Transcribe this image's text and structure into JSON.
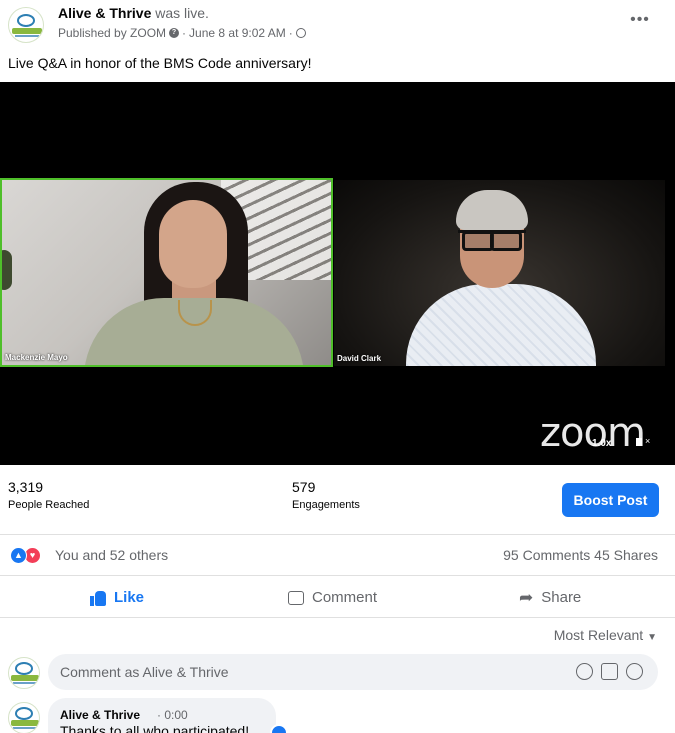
{
  "post": {
    "page_name": "Alive & Thrive",
    "was_live": "was live.",
    "published_by": "Published by ZOOM",
    "date": "June 8 at 9:02 AM",
    "more_label": "•••",
    "caption": "Live Q&A in honor of the BMS Code anniversary!"
  },
  "video": {
    "participant_left": "Mackenzie Mayo",
    "participant_right": "David Clark",
    "logo_text": "zoom",
    "speed": "1.0x"
  },
  "stats": {
    "reach_value": "3,319",
    "reach_label": "People Reached",
    "engagements_value": "579",
    "engagements_label": "Engagements",
    "boost_label": "Boost Post"
  },
  "reactions": {
    "summary": "You and 52 others",
    "comments": "95 Comments",
    "shares": "45 Shares"
  },
  "actions": {
    "like": "Like",
    "comment": "Comment",
    "share": "Share"
  },
  "comments": {
    "sort_label": "Most Relevant",
    "input_placeholder": "Comment as Alive & Thrive",
    "first": {
      "author": "Alive & Thrive",
      "time": "· 0:00",
      "text": "Thanks to all who participated!"
    }
  },
  "colors": {
    "accent": "#1877f2",
    "love": "#f33e58",
    "active_speaker": "#4fbf2a"
  }
}
